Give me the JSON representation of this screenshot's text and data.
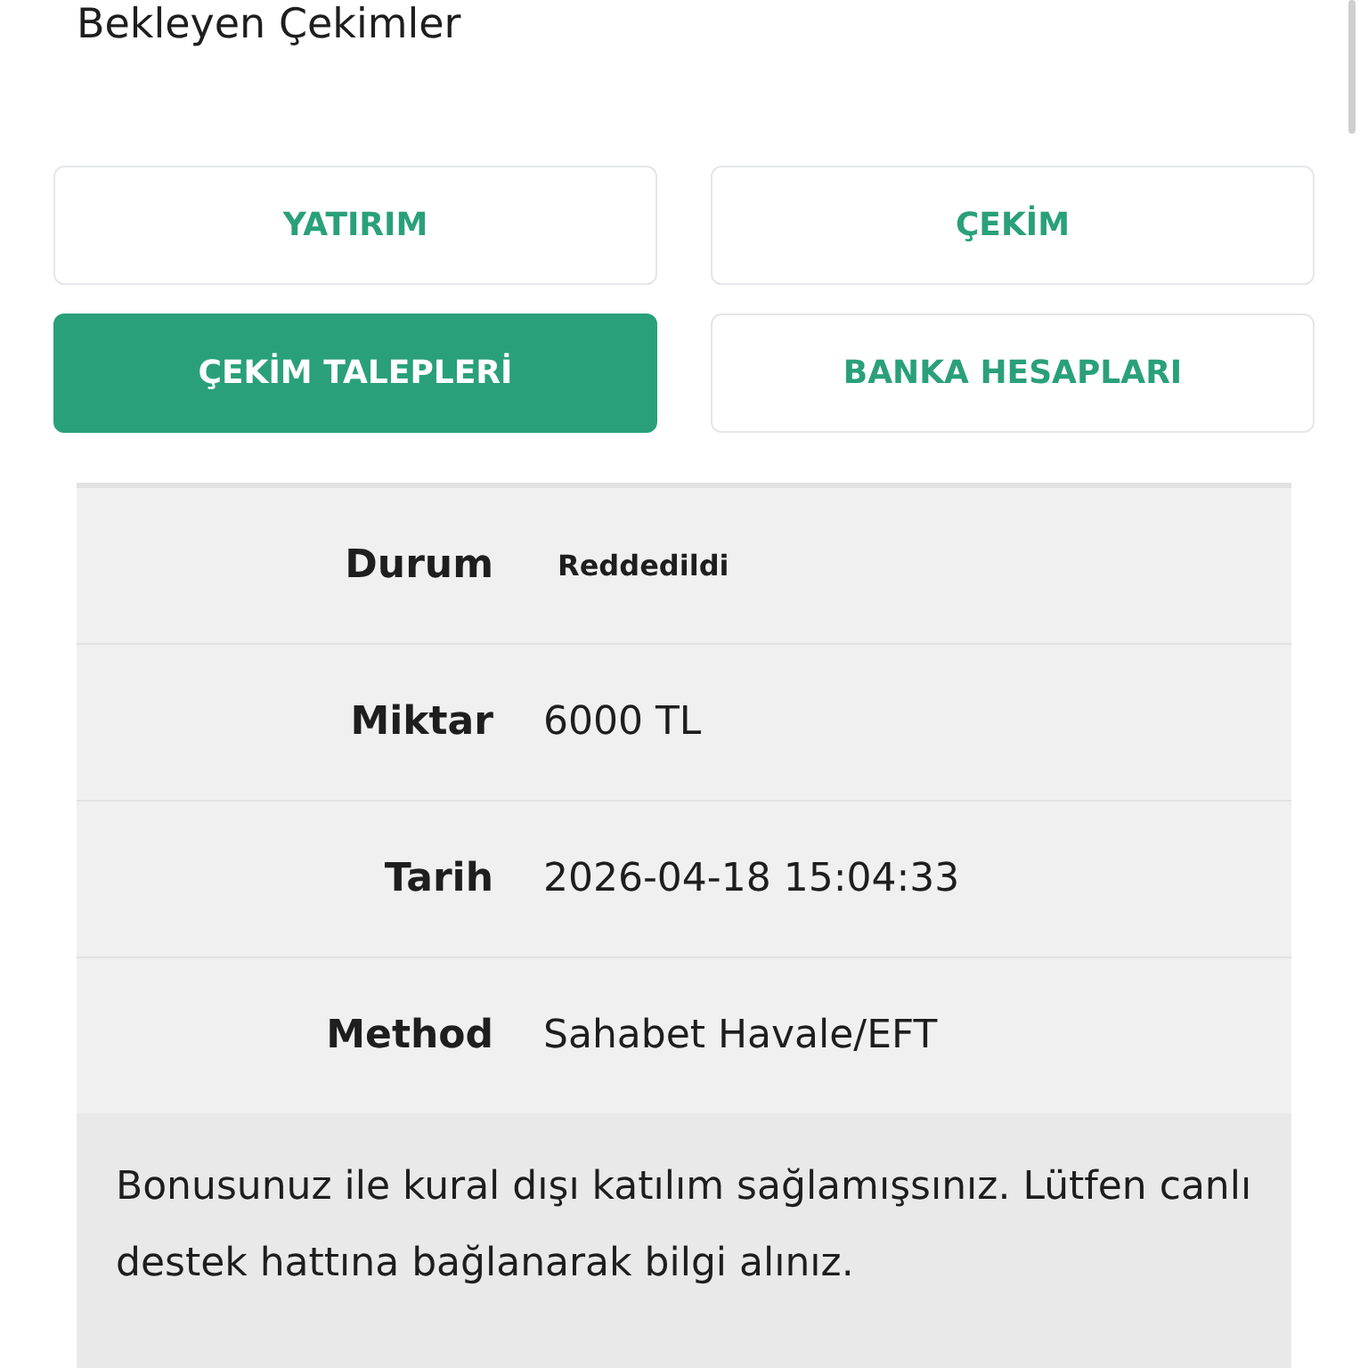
{
  "heading": "Bekleyen Çekimler",
  "tabs": [
    {
      "label": "YATIRIM",
      "selected": false
    },
    {
      "label": "ÇEKİM",
      "selected": false
    },
    {
      "label": "ÇEKİM TALEPLERİ",
      "selected": true
    },
    {
      "label": "BANKA HESAPLARI",
      "selected": false
    }
  ],
  "details": [
    {
      "kind": "status",
      "label": "Durum",
      "value": "Reddedildi"
    },
    {
      "kind": "text",
      "label": "Miktar",
      "value": "6000 TL"
    },
    {
      "kind": "text",
      "label": "Tarih",
      "value": "2026-04-18 15:04:33"
    },
    {
      "kind": "text",
      "label": "Method",
      "value": "Sahabet Havale/EFT"
    }
  ],
  "note": "Bonusunuz ile kural dışı katılım sağlamışsınız. Lütfen canlı destek hattına bağlanarak bilgi alınız."
}
